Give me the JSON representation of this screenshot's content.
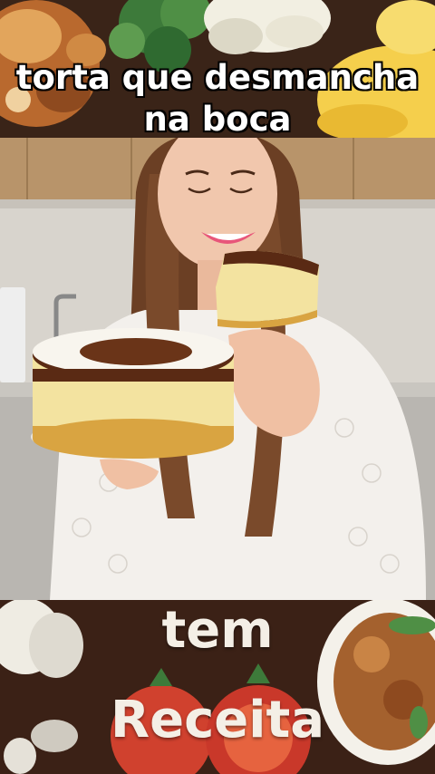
{
  "caption": {
    "line1": "torta que desmancha",
    "line2": "na boca"
  },
  "footer": {
    "word1": "tem",
    "word2": "Receita"
  },
  "colors": {
    "banner_background": "#3b2116",
    "caption_text": "#ffffff",
    "footer_text": "#f4efe6",
    "cake_crust": "#d9a441",
    "cake_filling": "#f3e3a0",
    "caramel_top": "#5a2a14",
    "coconut_topping": "#f8f5ee",
    "lips": "#e8567a"
  }
}
